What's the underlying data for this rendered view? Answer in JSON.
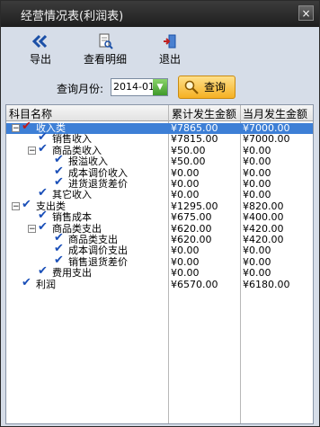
{
  "window": {
    "title": "经营情况表(利润表)",
    "close_label": "×"
  },
  "toolbar": {
    "export_label": "导出",
    "detail_label": "查看明细",
    "exit_label": "退出"
  },
  "query": {
    "month_label": "查询月份:",
    "month_value": "2014-01",
    "query_button": "查询"
  },
  "table": {
    "headers": [
      "科目名称",
      "累计发生金额",
      "当月发生金额"
    ],
    "rows": [
      {
        "name": "收入类",
        "level": 0,
        "expand": "−",
        "cum": "¥7865.00",
        "month": "¥7000.00",
        "selected": true
      },
      {
        "name": "销售收入",
        "level": 1,
        "expand": "",
        "cum": "¥7815.00",
        "month": "¥7000.00"
      },
      {
        "name": "商品类收入",
        "level": 1,
        "expand": "−",
        "cum": "¥50.00",
        "month": "¥0.00"
      },
      {
        "name": "报溢收入",
        "level": 2,
        "expand": "",
        "cum": "¥50.00",
        "month": "¥0.00"
      },
      {
        "name": "成本调价收入",
        "level": 2,
        "expand": "",
        "cum": "¥0.00",
        "month": "¥0.00"
      },
      {
        "name": "进货退货差价",
        "level": 2,
        "expand": "",
        "cum": "¥0.00",
        "month": "¥0.00"
      },
      {
        "name": "其它收入",
        "level": 1,
        "expand": "",
        "cum": "¥0.00",
        "month": "¥0.00"
      },
      {
        "name": "支出类",
        "level": 0,
        "expand": "−",
        "cum": "¥1295.00",
        "month": "¥820.00"
      },
      {
        "name": "销售成本",
        "level": 1,
        "expand": "",
        "cum": "¥675.00",
        "month": "¥400.00"
      },
      {
        "name": "商品类支出",
        "level": 1,
        "expand": "−",
        "cum": "¥620.00",
        "month": "¥420.00"
      },
      {
        "name": "商品类支出",
        "level": 2,
        "expand": "",
        "cum": "¥620.00",
        "month": "¥420.00"
      },
      {
        "name": "成本调价支出",
        "level": 2,
        "expand": "",
        "cum": "¥0.00",
        "month": "¥0.00"
      },
      {
        "name": "销售退货差价",
        "level": 2,
        "expand": "",
        "cum": "¥0.00",
        "month": "¥0.00"
      },
      {
        "name": "费用支出",
        "level": 1,
        "expand": "",
        "cum": "¥0.00",
        "month": "¥0.00"
      },
      {
        "name": "利润",
        "level": 0,
        "expand": "",
        "cum": "¥6570.00",
        "month": "¥6180.00"
      }
    ]
  },
  "icons": {
    "export": "double-chevron-left-icon",
    "detail": "document-magnifier-icon",
    "exit": "exit-door-icon",
    "query": "magnifier-icon",
    "check": "checkmark-icon"
  },
  "colors": {
    "selected_row": "#3d7fd6",
    "check": "#1a4fb8",
    "query_button": "#f5b023"
  }
}
